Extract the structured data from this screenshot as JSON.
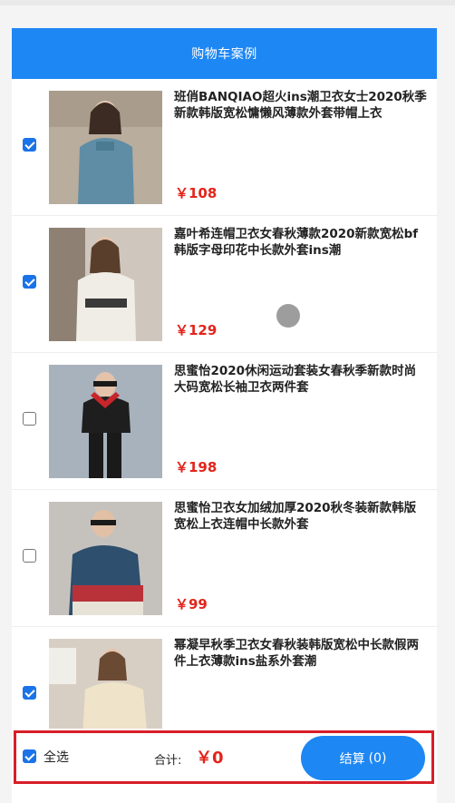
{
  "header": {
    "title": "购物车案例"
  },
  "items": [
    {
      "title": "班俏BANQIAO超火ins潮卫衣女士2020秋季新款韩版宽松慵懒风薄款外套带帽上衣",
      "price": "￥108",
      "checked": true
    },
    {
      "title": "嘉叶希连帽卫衣女春秋薄款2020新款宽松bf韩版字母印花中长款外套ins潮",
      "price": "￥129",
      "checked": true
    },
    {
      "title": "思蜜怡2020休闲运动套装女春秋季新款时尚大码宽松长袖卫衣两件套",
      "price": "￥198",
      "checked": false
    },
    {
      "title": "思蜜怡卫衣女加绒加厚2020秋冬装新款韩版宽松上衣连帽中长款外套",
      "price": "￥99",
      "checked": false
    },
    {
      "title": "幂凝早秋季卫衣女春秋装韩版宽松中长款假两件上衣薄款ins盐系外套潮",
      "price": "",
      "checked": true
    }
  ],
  "footer": {
    "select_all_label": "全选",
    "select_all_checked": true,
    "total_label": "合计:",
    "total_value": "￥0",
    "checkout_label": "结算",
    "checkout_count": "(0)"
  },
  "colors": {
    "primary": "#1d87f4",
    "price": "#e3241b",
    "highlight_border": "#d71e28"
  }
}
